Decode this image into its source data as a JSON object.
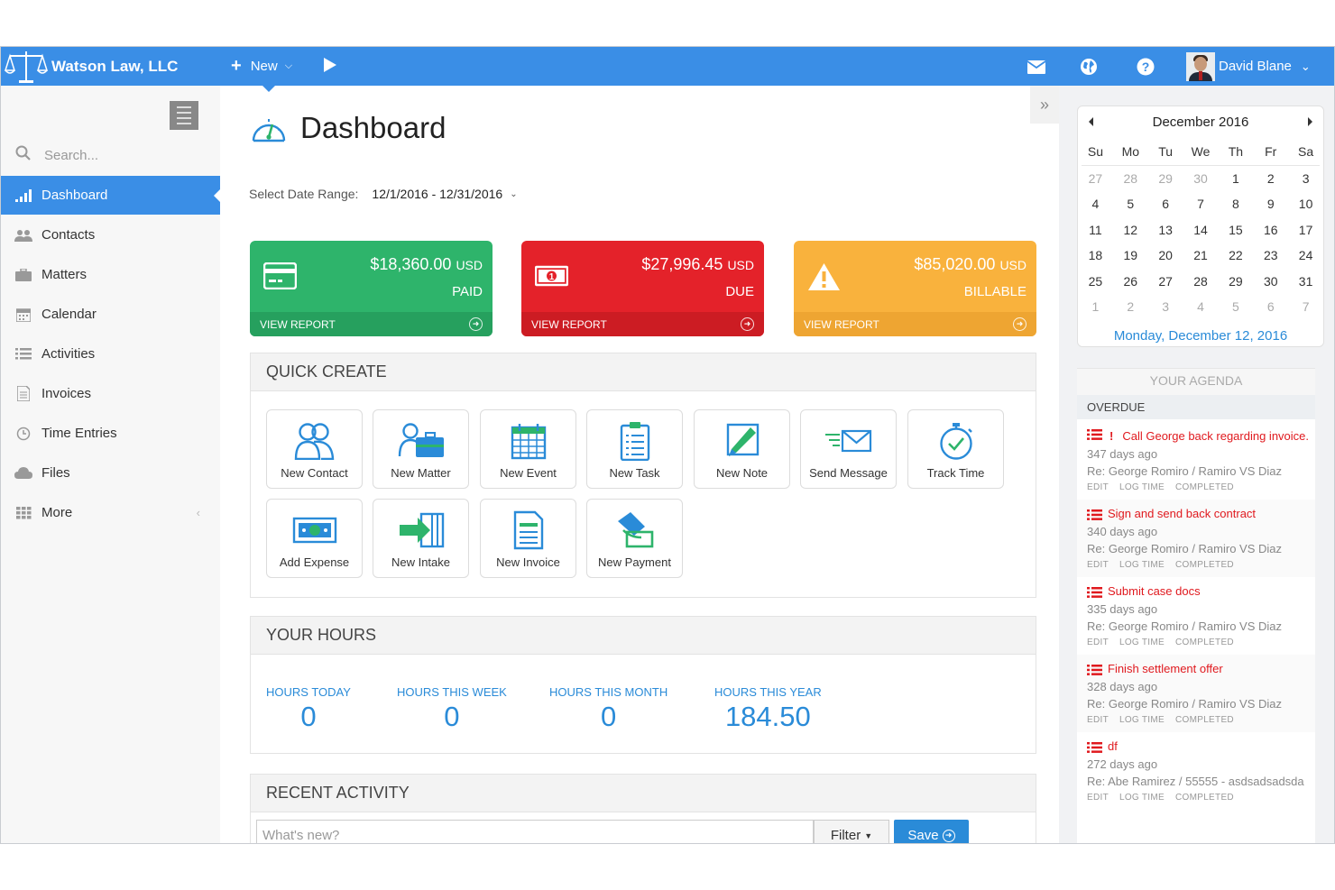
{
  "topbar": {
    "brand": "Watson Law, LLC",
    "new_label": "New",
    "user_name": "David Blane"
  },
  "sidebar": {
    "search_placeholder": "Search...",
    "items": [
      {
        "label": "Dashboard",
        "icon": "bar-chart-icon"
      },
      {
        "label": "Contacts",
        "icon": "users-icon"
      },
      {
        "label": "Matters",
        "icon": "briefcase-icon"
      },
      {
        "label": "Calendar",
        "icon": "calendar-icon"
      },
      {
        "label": "Activities",
        "icon": "list-icon"
      },
      {
        "label": "Invoices",
        "icon": "document-icon"
      },
      {
        "label": "Time Entries",
        "icon": "clock-icon"
      },
      {
        "label": "Files",
        "icon": "cloud-icon"
      },
      {
        "label": "More",
        "icon": "grid-icon"
      }
    ]
  },
  "main": {
    "title": "Dashboard",
    "date_range_label": "Select Date Range:",
    "date_range_value": "12/1/2016 - 12/31/2016",
    "cards": {
      "paid": {
        "amount": "$18,360.00",
        "currency": "USD",
        "label": "PAID",
        "link": "VIEW REPORT",
        "color": "#2eb46b"
      },
      "due": {
        "amount": "$27,996.45",
        "currency": "USD",
        "label": "DUE",
        "link": "VIEW REPORT",
        "color": "#e4222a"
      },
      "billable": {
        "amount": "$85,020.00",
        "currency": "USD",
        "label": "BILLABLE",
        "link": "VIEW REPORT",
        "color": "#f9b23d"
      }
    },
    "quick_create": {
      "title": "QUICK CREATE",
      "tiles": [
        {
          "label": "New Contact",
          "icon": "contacts-icon"
        },
        {
          "label": "New Matter",
          "icon": "matter-icon"
        },
        {
          "label": "New Event",
          "icon": "event-calendar-icon"
        },
        {
          "label": "New Task",
          "icon": "task-clipboard-icon"
        },
        {
          "label": "New Note",
          "icon": "note-pen-icon"
        },
        {
          "label": "Send Message",
          "icon": "envelope-icon"
        },
        {
          "label": "Track Time",
          "icon": "stopwatch-icon"
        },
        {
          "label": "Add Expense",
          "icon": "cash-icon"
        },
        {
          "label": "New Intake",
          "icon": "intake-arrow-icon"
        },
        {
          "label": "New Invoice",
          "icon": "invoice-icon"
        },
        {
          "label": "New Payment",
          "icon": "payment-icon"
        }
      ]
    },
    "hours": {
      "title": "YOUR HOURS",
      "items": [
        {
          "label": "HOURS TODAY",
          "value": "0"
        },
        {
          "label": "HOURS THIS WEEK",
          "value": "0"
        },
        {
          "label": "HOURS THIS MONTH",
          "value": "0"
        },
        {
          "label": "HOURS THIS YEAR",
          "value": "184.50"
        }
      ]
    },
    "recent_activity": {
      "title": "RECENT ACTIVITY",
      "placeholder": "What's new?",
      "filter_label": "Filter",
      "save_label": "Save"
    }
  },
  "calendar": {
    "month": "December 2016",
    "weekdays": [
      "Su",
      "Mo",
      "Tu",
      "We",
      "Th",
      "Fr",
      "Sa"
    ],
    "weeks": [
      [
        {
          "d": "27",
          "o": true
        },
        {
          "d": "28",
          "o": true
        },
        {
          "d": "29",
          "o": true
        },
        {
          "d": "30",
          "o": true
        },
        {
          "d": "1"
        },
        {
          "d": "2"
        },
        {
          "d": "3"
        }
      ],
      [
        {
          "d": "4"
        },
        {
          "d": "5"
        },
        {
          "d": "6"
        },
        {
          "d": "7"
        },
        {
          "d": "8"
        },
        {
          "d": "9"
        },
        {
          "d": "10"
        }
      ],
      [
        {
          "d": "11"
        },
        {
          "d": "12"
        },
        {
          "d": "13"
        },
        {
          "d": "14"
        },
        {
          "d": "15"
        },
        {
          "d": "16"
        },
        {
          "d": "17"
        }
      ],
      [
        {
          "d": "18"
        },
        {
          "d": "19"
        },
        {
          "d": "20"
        },
        {
          "d": "21"
        },
        {
          "d": "22"
        },
        {
          "d": "23"
        },
        {
          "d": "24"
        }
      ],
      [
        {
          "d": "25"
        },
        {
          "d": "26"
        },
        {
          "d": "27"
        },
        {
          "d": "28"
        },
        {
          "d": "29"
        },
        {
          "d": "30"
        },
        {
          "d": "31"
        }
      ],
      [
        {
          "d": "1",
          "o": true
        },
        {
          "d": "2",
          "o": true
        },
        {
          "d": "3",
          "o": true
        },
        {
          "d": "4",
          "o": true
        },
        {
          "d": "5",
          "o": true
        },
        {
          "d": "6",
          "o": true
        },
        {
          "d": "7",
          "o": true
        }
      ]
    ],
    "selected_label": "Monday, December 12, 2016"
  },
  "agenda": {
    "title": "YOUR AGENDA",
    "section": "OVERDUE",
    "actions": [
      "EDIT",
      "LOG TIME",
      "COMPLETED"
    ],
    "items": [
      {
        "title": "Call George back regarding invoice.",
        "urgent": true,
        "age": "347 days ago",
        "re": "Re: George Romiro / Ramiro VS Diaz"
      },
      {
        "title": "Sign and send back contract",
        "urgent": false,
        "age": "340 days ago",
        "re": "Re: George Romiro / Ramiro VS Diaz"
      },
      {
        "title": "Submit case docs",
        "urgent": false,
        "age": "335 days ago",
        "re": "Re: George Romiro / Ramiro VS Diaz"
      },
      {
        "title": "Finish settlement offer",
        "urgent": false,
        "age": "328 days ago",
        "re": "Re: George Romiro / Ramiro VS Diaz"
      },
      {
        "title": "df",
        "urgent": false,
        "age": "272 days ago",
        "re": "Re: Abe Ramirez / 55555 - asdsadsadsda"
      }
    ]
  }
}
